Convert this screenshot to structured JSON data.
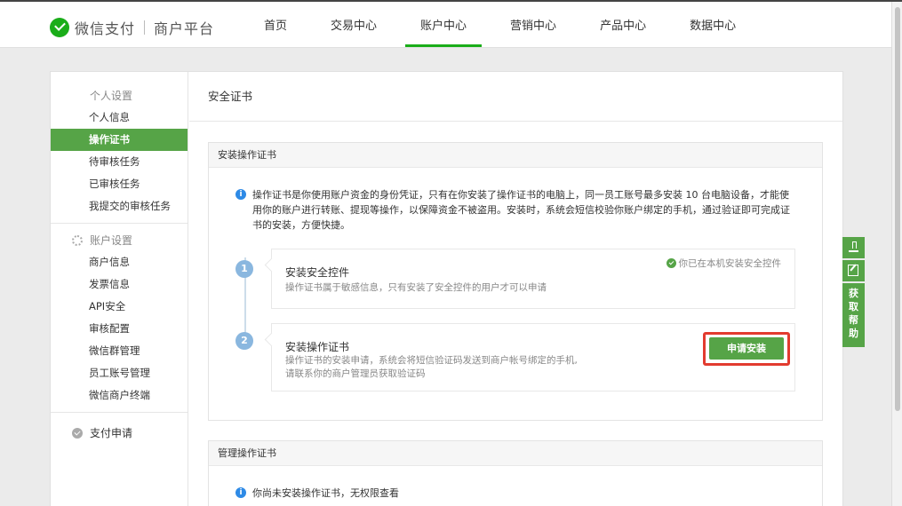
{
  "header": {
    "brand": "微信支付",
    "brand_sub": "商户平台",
    "nav": [
      {
        "label": "首页"
      },
      {
        "label": "交易中心"
      },
      {
        "label": "账户中心"
      },
      {
        "label": "营销中心"
      },
      {
        "label": "产品中心"
      },
      {
        "label": "数据中心"
      }
    ],
    "active_nav": "账户中心"
  },
  "sidebar": {
    "personal": {
      "title": "个人设置",
      "icon": "grid-icon",
      "items": [
        "个人信息",
        "操作证书",
        "待审核任务",
        "已审核任务",
        "我提交的审核任务"
      ],
      "active": "操作证书"
    },
    "account": {
      "title": "账户设置",
      "icon": "gear-icon",
      "items": [
        "商户信息",
        "发票信息",
        "API安全",
        "审核配置",
        "微信群管理",
        "员工账号管理",
        "微信商户终端"
      ]
    },
    "pay": {
      "title": "支付申请",
      "icon": "pay-icon"
    }
  },
  "main": {
    "title": "安全证书",
    "install_panel": {
      "heading": "安装操作证书",
      "description": "操作证书是你使用账户资金的身份凭证，只有在你安装了操作证书的电脑上，同一员工账号最多安装 10 台电脑设备，才能使用你的账户进行转账、提现等操作，以保障资金不被盗用。安装时，系统会短信校验你账户绑定的手机，通过验证即可完成证书的安装，方便快捷。",
      "steps": [
        {
          "number": "1",
          "title": "安装安全控件",
          "subtitle": "操作证书属于敏感信息，只有安装了安全控件的用户才可以申请",
          "status": "你已在本机安装安全控件"
        },
        {
          "number": "2",
          "title": "安装操作证书",
          "subtitle_line1": "操作证书的安装申请，系统会将短信验证码发送到商户帐号绑定的手机,",
          "subtitle_line2": "请联系你的商户管理员获取验证码",
          "button": "申请安装"
        }
      ]
    },
    "manage_panel": {
      "heading": "管理操作证书",
      "notice": "你尚未安装操作证书，无权限查看"
    }
  },
  "float_bar": {
    "help_label": "获取帮助",
    "help_chars": [
      "获",
      "取",
      "帮",
      "助"
    ]
  },
  "colors": {
    "brand_green": "#1aad19",
    "accent_green": "#56a447",
    "highlight_red": "#e23b2f",
    "info_blue": "#2e8ae6"
  }
}
